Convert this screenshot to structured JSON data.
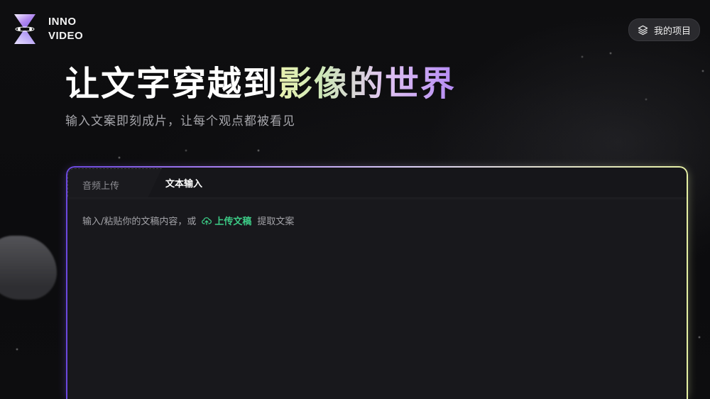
{
  "brand": {
    "line1": "INNO",
    "line2": "VIDEO"
  },
  "header": {
    "projects_label": "我的项目"
  },
  "hero": {
    "headline_plain": "让文字穿越到",
    "headline_gradient": "影像的世界",
    "subtitle": "输入文案即刻成片，让每个观点都被看见"
  },
  "tabs": [
    {
      "label": "音频上传",
      "active": false
    },
    {
      "label": "文本输入",
      "active": true
    }
  ],
  "editor": {
    "placeholder_prefix": "输入/粘贴你的文稿内容，或",
    "upload_label": "上传文稿",
    "placeholder_suffix": "提取文案"
  },
  "colors": {
    "accent_green": "#3ccb86",
    "gradient": [
      "#6c48e0",
      "#a77ff0",
      "#d9cdf4",
      "#e6f0a4"
    ]
  },
  "icons": {
    "projects": "layers-icon",
    "upload": "cloud-upload-icon",
    "logo": "hourglass-logo-icon"
  }
}
